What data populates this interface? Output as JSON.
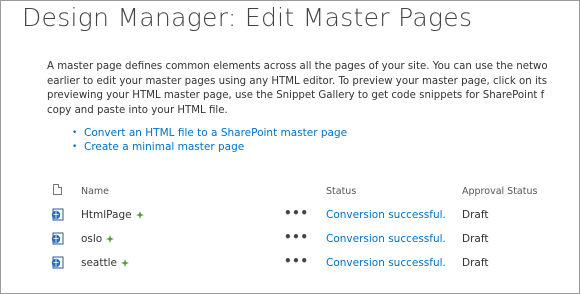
{
  "page": {
    "title": "Design Manager: Edit Master Pages"
  },
  "description": {
    "lines": [
      "A master page defines common elements across all the pages of your site. You can use the netwo",
      "earlier to edit your master pages using any HTML editor. To preview your master page, click on its",
      "previewing your HTML master page, use the Snippet Gallery to get code snippets for SharePoint f",
      "copy and paste into your HTML file."
    ]
  },
  "links": [
    {
      "label": "Convert an HTML file to a SharePoint master page"
    },
    {
      "label": "Create a minimal master page"
    }
  ],
  "table": {
    "columns": {
      "name": "Name",
      "status": "Status",
      "approval": "Approval Status"
    },
    "rows": [
      {
        "name": "HtmlPage",
        "menu": "•••",
        "status": "Conversion successful.",
        "approval": "Draft"
      },
      {
        "name": "oslo",
        "menu": "•••",
        "status": "Conversion successful.",
        "approval": "Draft"
      },
      {
        "name": "seattle",
        "menu": "•••",
        "status": "Conversion successful.",
        "approval": "Draft"
      }
    ]
  },
  "icons": {
    "header_icon": "document-icon",
    "row_icon": "html-file-icon",
    "checked_out": "checked-out-icon"
  },
  "colors": {
    "link": "#0072c6",
    "text": "#333333",
    "title": "#444444",
    "check": "#4aa02c"
  }
}
